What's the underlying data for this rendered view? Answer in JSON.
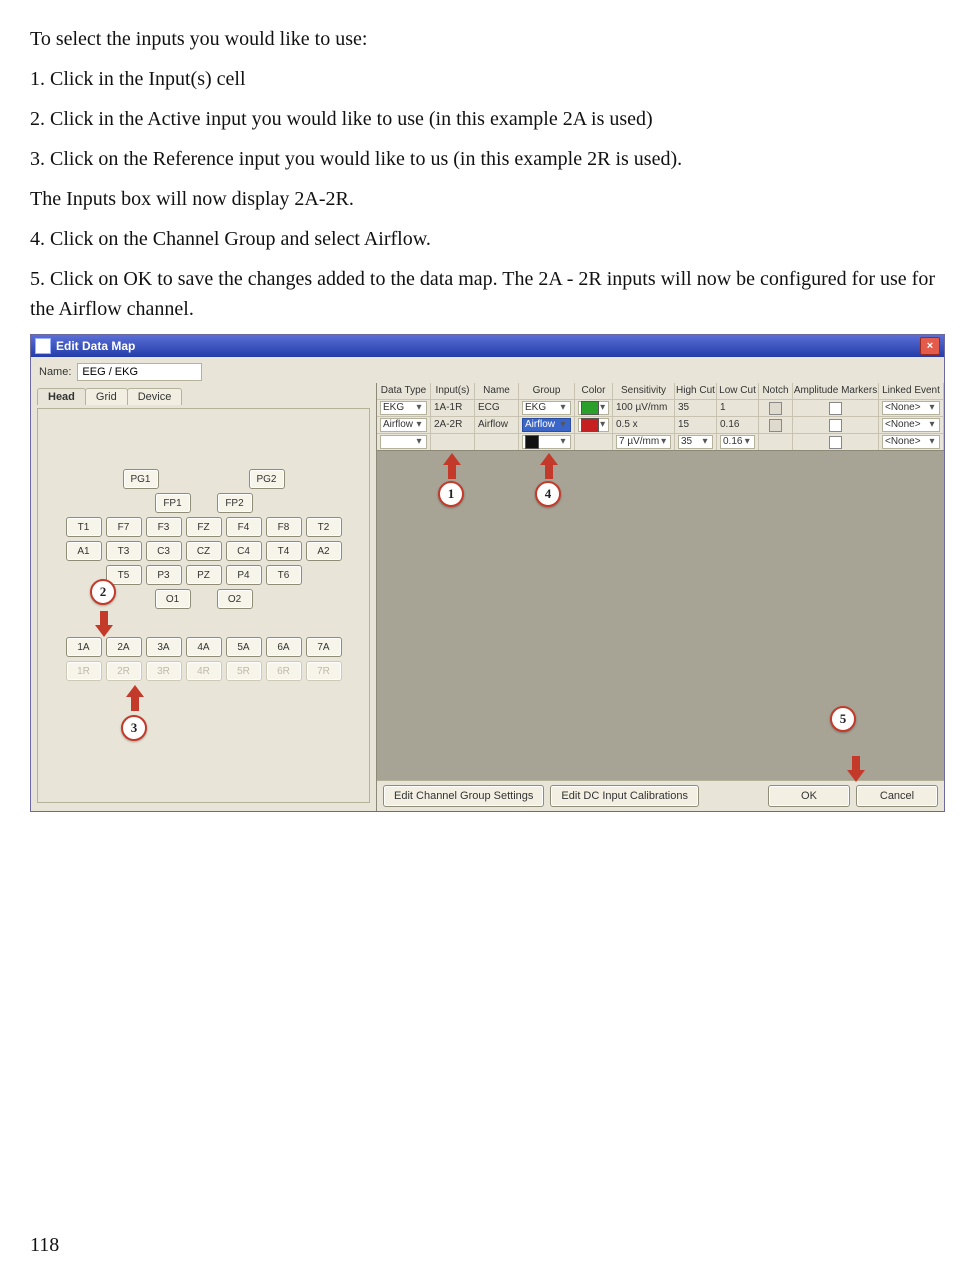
{
  "text": {
    "intro": "To select the inputs you would like to use:",
    "s1": "1.  Click in the Input(s) cell",
    "s2": "2.  Click in the Active input you would like to use (in this example 2A is used)",
    "s3": "3.  Click on the Reference input you would like to us (in this example 2R is used).",
    "result": "The Inputs box will now display 2A-2R.",
    "s4": "4.  Click on the Channel Group and select Airflow.",
    "s5": "5.  Click on OK to save the changes added to the data map.  The 2A - 2R inputs will now be configured for use for the Airflow channel.",
    "pagenum": "118"
  },
  "win": {
    "title": "Edit Data Map",
    "name_label": "Name:",
    "name_value": "EEG / EKG",
    "tabs": [
      "Head",
      "Grid",
      "Device"
    ],
    "headers": [
      "Data Type",
      "Input(s)",
      "Name",
      "Group",
      "Color",
      "Sensitivity",
      "High Cut",
      "Low Cut",
      "Notch",
      "Amplitude Markers",
      "Linked Event"
    ],
    "rows": [
      {
        "type": "EKG",
        "inputs": "1A-1R",
        "name": "ECG",
        "group": "EKG",
        "color": "#2aa02a",
        "sens": "100 µV/mm",
        "hcut": "35",
        "lcut": "1",
        "linked": "<None>"
      },
      {
        "type": "Airflow",
        "inputs": "2A-2R",
        "name": "Airflow",
        "group": "Airflow",
        "group_hl": true,
        "color": "#c62020",
        "sens": "0.5 x",
        "hcut": "15",
        "lcut": "0.16",
        "linked": "<None>"
      },
      {
        "type": "",
        "inputs": "",
        "name": "",
        "group": "",
        "color": "#111",
        "sens": "7 µV/mm",
        "hcut": "35",
        "lcut": "0.16",
        "linked": "<None>"
      }
    ],
    "btn_group": "Edit Channel Group Settings",
    "btn_calib": "Edit DC Input Calibrations",
    "btn_ok": "OK",
    "btn_cancel": "Cancel",
    "electrodes": {
      "r1": [
        "PG1",
        "PG2"
      ],
      "r2": [
        "FP1",
        "FP2"
      ],
      "r3": [
        "T1",
        "F7",
        "F3",
        "FZ",
        "F4",
        "F8",
        "T2"
      ],
      "r4": [
        "A1",
        "T3",
        "C3",
        "CZ",
        "C4",
        "T4",
        "A2"
      ],
      "r5": [
        "T5",
        "P3",
        "PZ",
        "P4",
        "T6"
      ],
      "r6": [
        "O1",
        "O2"
      ],
      "rA": [
        "1A",
        "2A",
        "3A",
        "4A",
        "5A",
        "6A",
        "7A"
      ],
      "rR": [
        "1R",
        "2R",
        "3R",
        "4R",
        "5R",
        "6R",
        "7R"
      ]
    },
    "callouts": {
      "1": "1",
      "2": "2",
      "3": "3",
      "4": "4",
      "5": "5"
    }
  }
}
